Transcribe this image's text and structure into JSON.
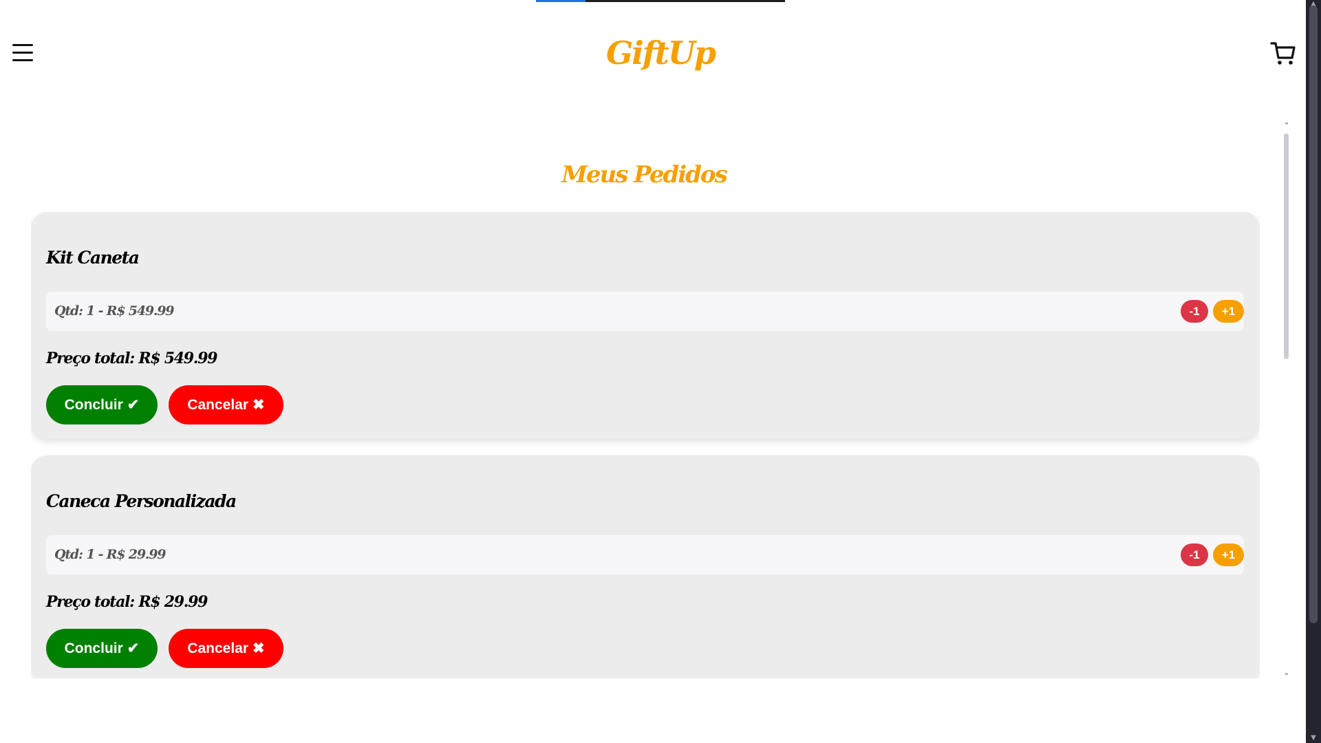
{
  "header": {
    "brand": "GiftUp",
    "load_progress": 0.2
  },
  "page_title": "Meus Pedidos",
  "orders": [
    {
      "name": "Kit Caneta",
      "qty_line": "Qtd: 1 - R$ 549.99",
      "decrement_label": "-1",
      "increment_label": "+1",
      "total_line": "Preço total: R$ 549.99",
      "confirm_label": "Concluir",
      "cancel_label": "Cancelar"
    },
    {
      "name": "Caneca Personalizada",
      "qty_line": "Qtd: 1 - R$ 29.99",
      "decrement_label": "-1",
      "increment_label": "+1",
      "total_line": "Preço total: R$ 29.99",
      "confirm_label": "Concluir",
      "cancel_label": "Cancelar"
    }
  ],
  "icons": {
    "menu": "hamburger-menu-icon",
    "cart": "shopping-cart-icon",
    "confirm": "checkmark-icon",
    "cancel": "close-x-icon"
  },
  "colors": {
    "brand": "#f5a000",
    "confirm": "#008000",
    "cancel": "#ff0000",
    "decrement": "#dc3545",
    "increment": "#f5a000",
    "card_bg": "#ececec"
  }
}
